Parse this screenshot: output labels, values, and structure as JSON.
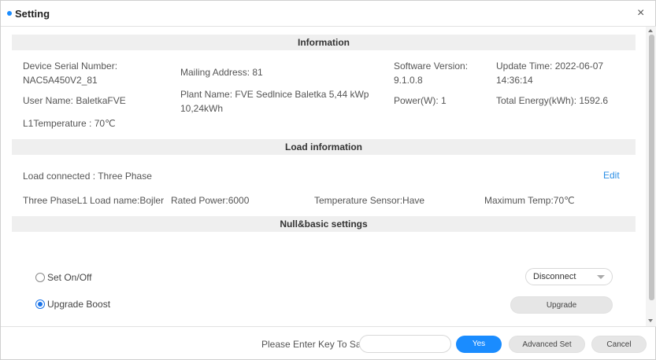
{
  "dialog": {
    "title": "Setting",
    "close_glyph": "×"
  },
  "information": {
    "header": "Information",
    "device_serial_label": "Device Serial Number:",
    "device_serial_value": "NAC5A450V2_81",
    "mailing_address": "Mailing Address: 81",
    "software_version_label": "Software Version:",
    "software_version_value": "9.1.0.8",
    "update_time_label": "Update Time: 2022-06-07",
    "update_time_value": "14:36:14",
    "user_name": "User Name: BaletkaFVE",
    "plant_name_line1": "Plant Name: FVE Sedlnice Baletka 5,44 kWp",
    "plant_name_line2": "10,24kWh",
    "power": "Power(W): 1",
    "total_energy": "Total Energy(kWh): 1592.6",
    "l1_temperature": "L1Temperature : 70℃"
  },
  "load": {
    "header": "Load information",
    "connected": "Load connected : Three Phase",
    "edit_label": "Edit",
    "phase": "Three PhaseL1",
    "load_name": "Load name:Bojler",
    "rated_power": "Rated Power:6000",
    "temp_sensor": "Temperature Sensor:Have",
    "max_temp": "Maximum Temp:70℃"
  },
  "basic": {
    "header": "Null&basic settings",
    "set_onoff_label": "Set On/Off",
    "set_onoff_checked": false,
    "upgrade_boost_label": "Upgrade Boost",
    "upgrade_boost_checked": true,
    "select_value": "Disconnect",
    "upgrade_button": "Upgrade"
  },
  "footer": {
    "key_label": "Please Enter Key To Save:",
    "key_value": "",
    "key_placeholder": "",
    "yes_button": "Yes",
    "advanced_button": "Advanced Set",
    "cancel_button": "Cancel"
  },
  "colors": {
    "accent": "#1a8cff",
    "link": "#2b8fe6",
    "section_bg": "#efefef"
  }
}
